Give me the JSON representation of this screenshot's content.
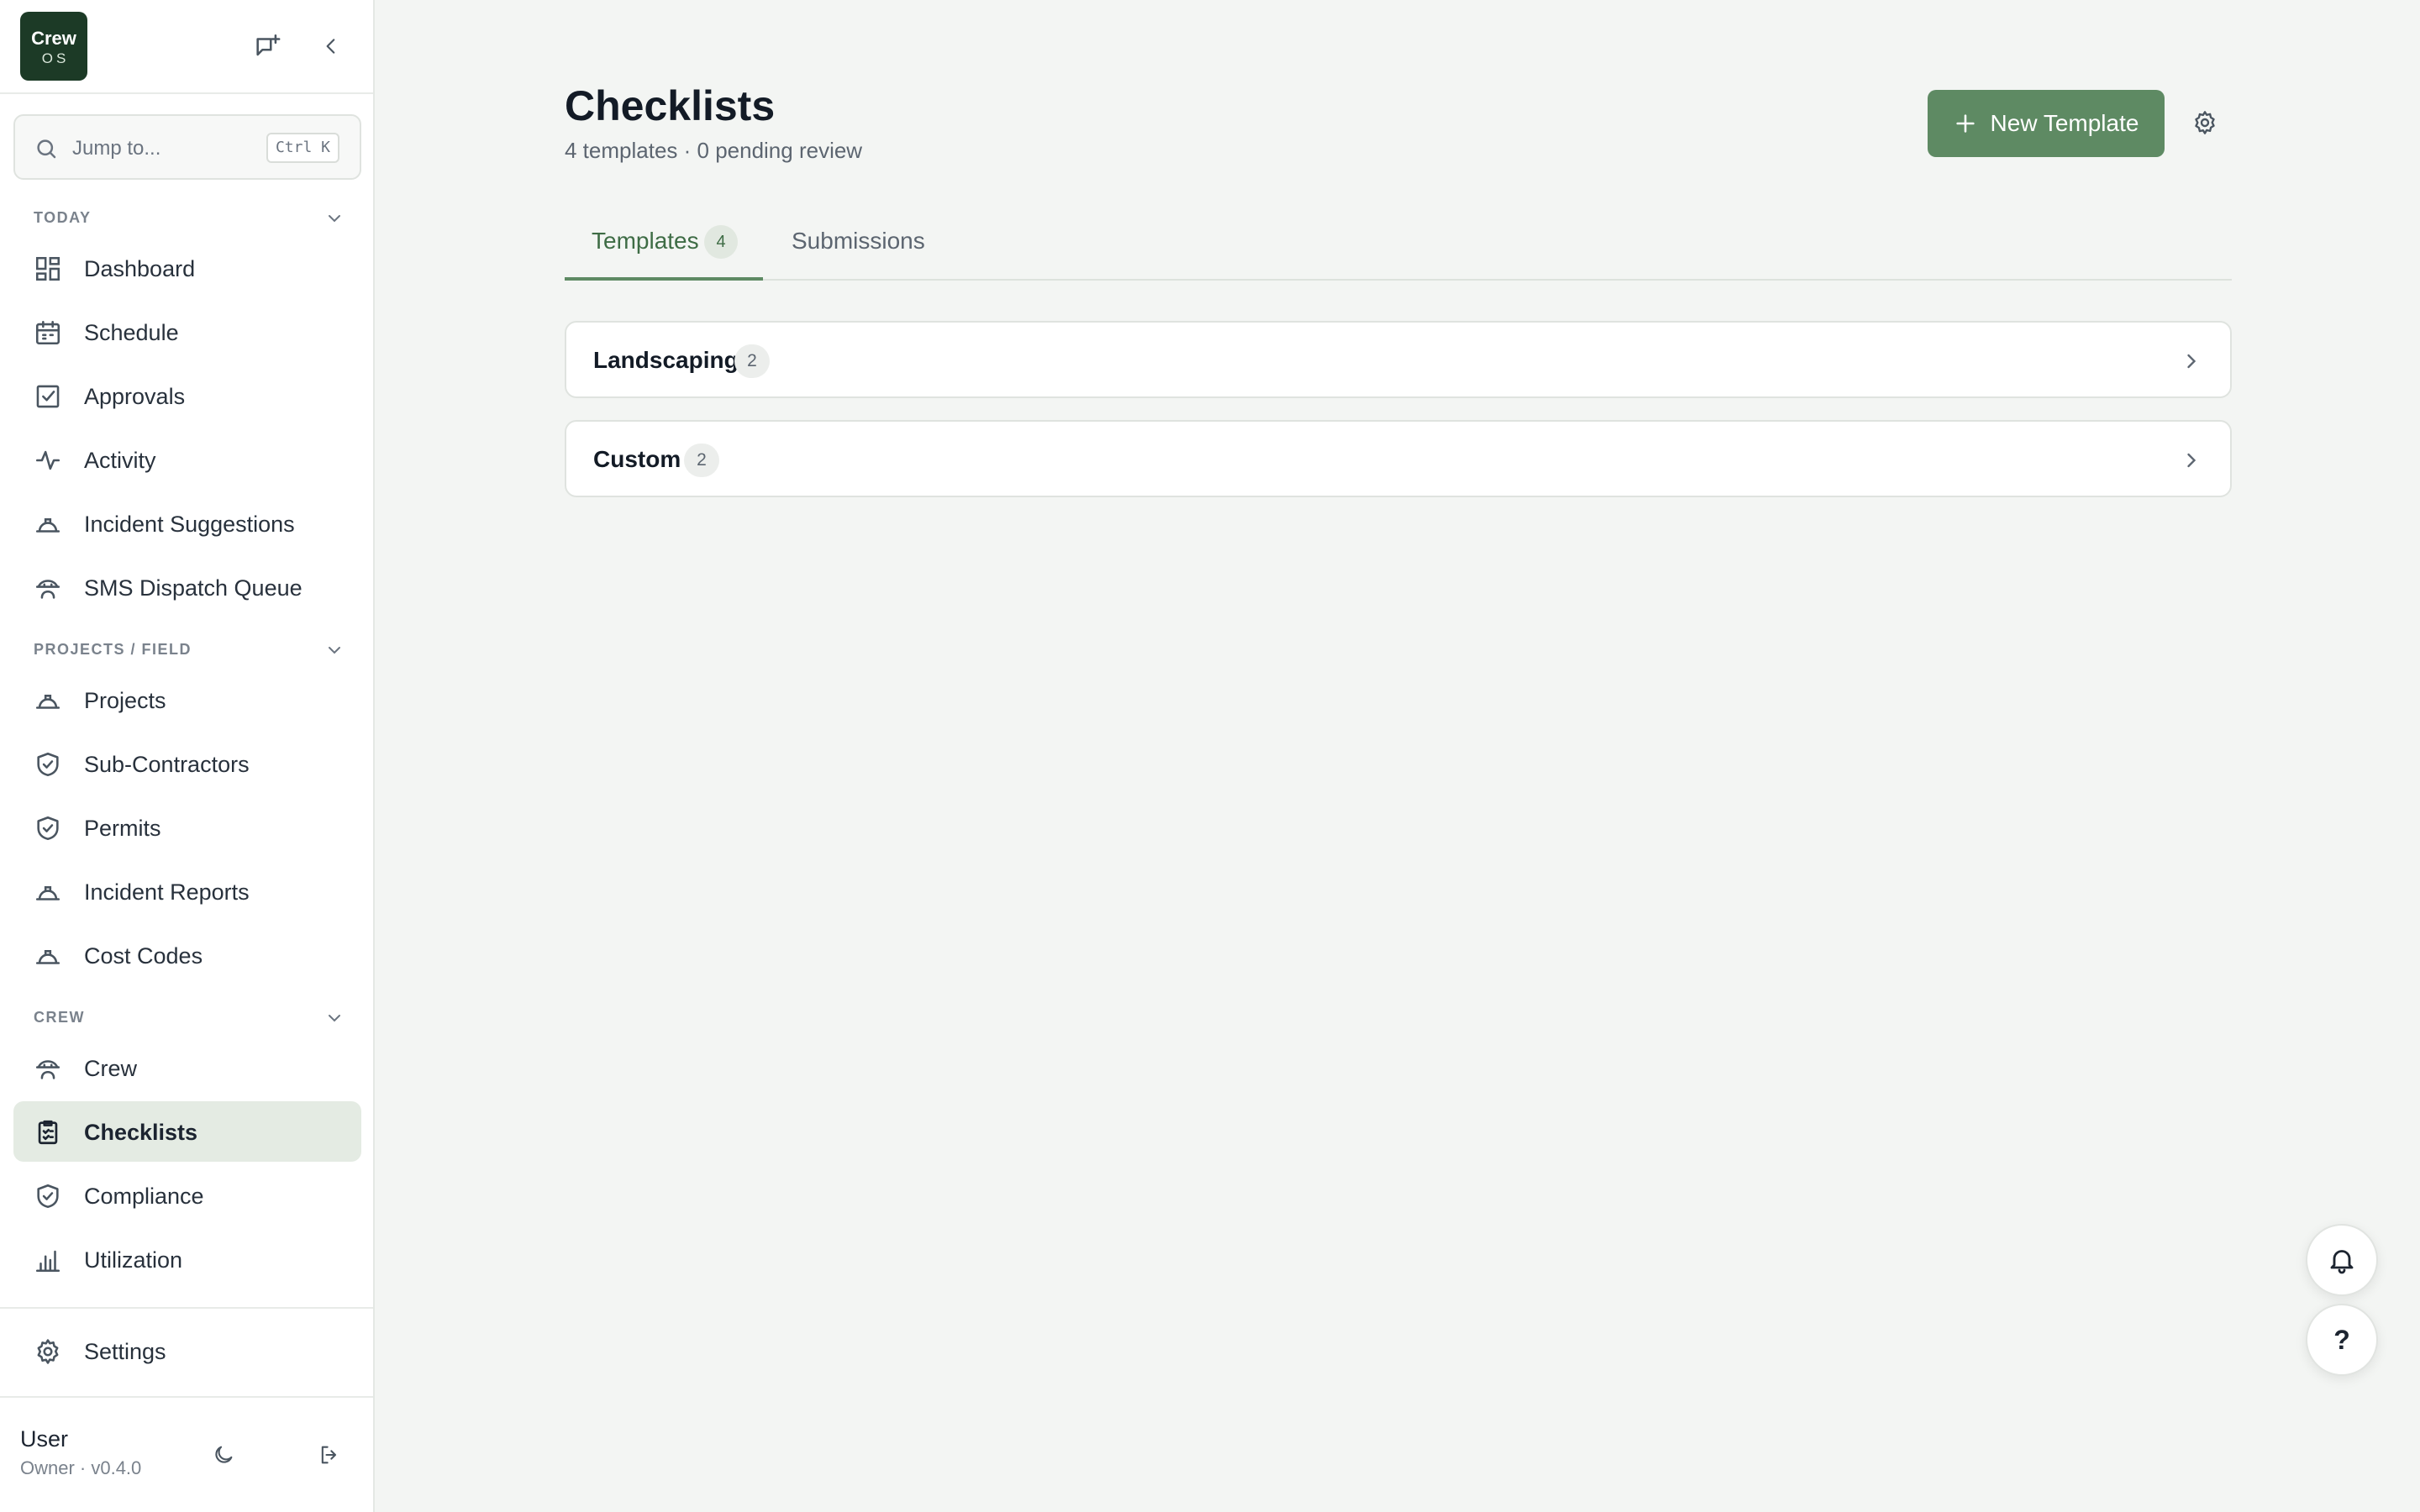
{
  "brand": {
    "line1": "Crew",
    "line2": "OS"
  },
  "search": {
    "placeholder": "Jump to...",
    "shortcut": "Ctrl K"
  },
  "sidebar": {
    "sections": [
      {
        "title": "TODAY",
        "items": [
          {
            "label": "Dashboard",
            "icon": "dashboard-icon"
          },
          {
            "label": "Schedule",
            "icon": "calendar-icon"
          },
          {
            "label": "Approvals",
            "icon": "checkbox-icon"
          },
          {
            "label": "Activity",
            "icon": "activity-icon"
          },
          {
            "label": "Incident Suggestions",
            "icon": "hardhat-icon"
          },
          {
            "label": "SMS Dispatch Queue",
            "icon": "crew-icon"
          }
        ]
      },
      {
        "title": "PROJECTS / FIELD",
        "items": [
          {
            "label": "Projects",
            "icon": "hardhat-icon"
          },
          {
            "label": "Sub-Contractors",
            "icon": "shield-icon"
          },
          {
            "label": "Permits",
            "icon": "shield-icon"
          },
          {
            "label": "Incident Reports",
            "icon": "hardhat-icon"
          },
          {
            "label": "Cost Codes",
            "icon": "hardhat-icon"
          }
        ]
      },
      {
        "title": "CREW",
        "items": [
          {
            "label": "Crew",
            "icon": "crew-icon"
          },
          {
            "label": "Checklists",
            "icon": "clipboard-icon",
            "active": true
          },
          {
            "label": "Compliance",
            "icon": "shield-icon"
          },
          {
            "label": "Utilization",
            "icon": "bar-chart-icon"
          }
        ]
      }
    ],
    "settings_label": "Settings",
    "user": {
      "name": "User",
      "role": "Owner · v0.4.0"
    }
  },
  "main": {
    "title": "Checklists",
    "subtitle": "4 templates · 0 pending review",
    "new_button": "New Template",
    "tabs": [
      {
        "label": "Templates",
        "count": "4",
        "active": true
      },
      {
        "label": "Submissions"
      }
    ],
    "groups": [
      {
        "name": "Landscaping",
        "count": "2"
      },
      {
        "name": "Custom",
        "count": "2"
      }
    ]
  },
  "help_label": "?",
  "colors": {
    "accent": "#5e8a63",
    "brand_bg": "#1c3a26",
    "active_nav_bg": "#e4ebe3",
    "page_bg": "#f3f5f3"
  }
}
